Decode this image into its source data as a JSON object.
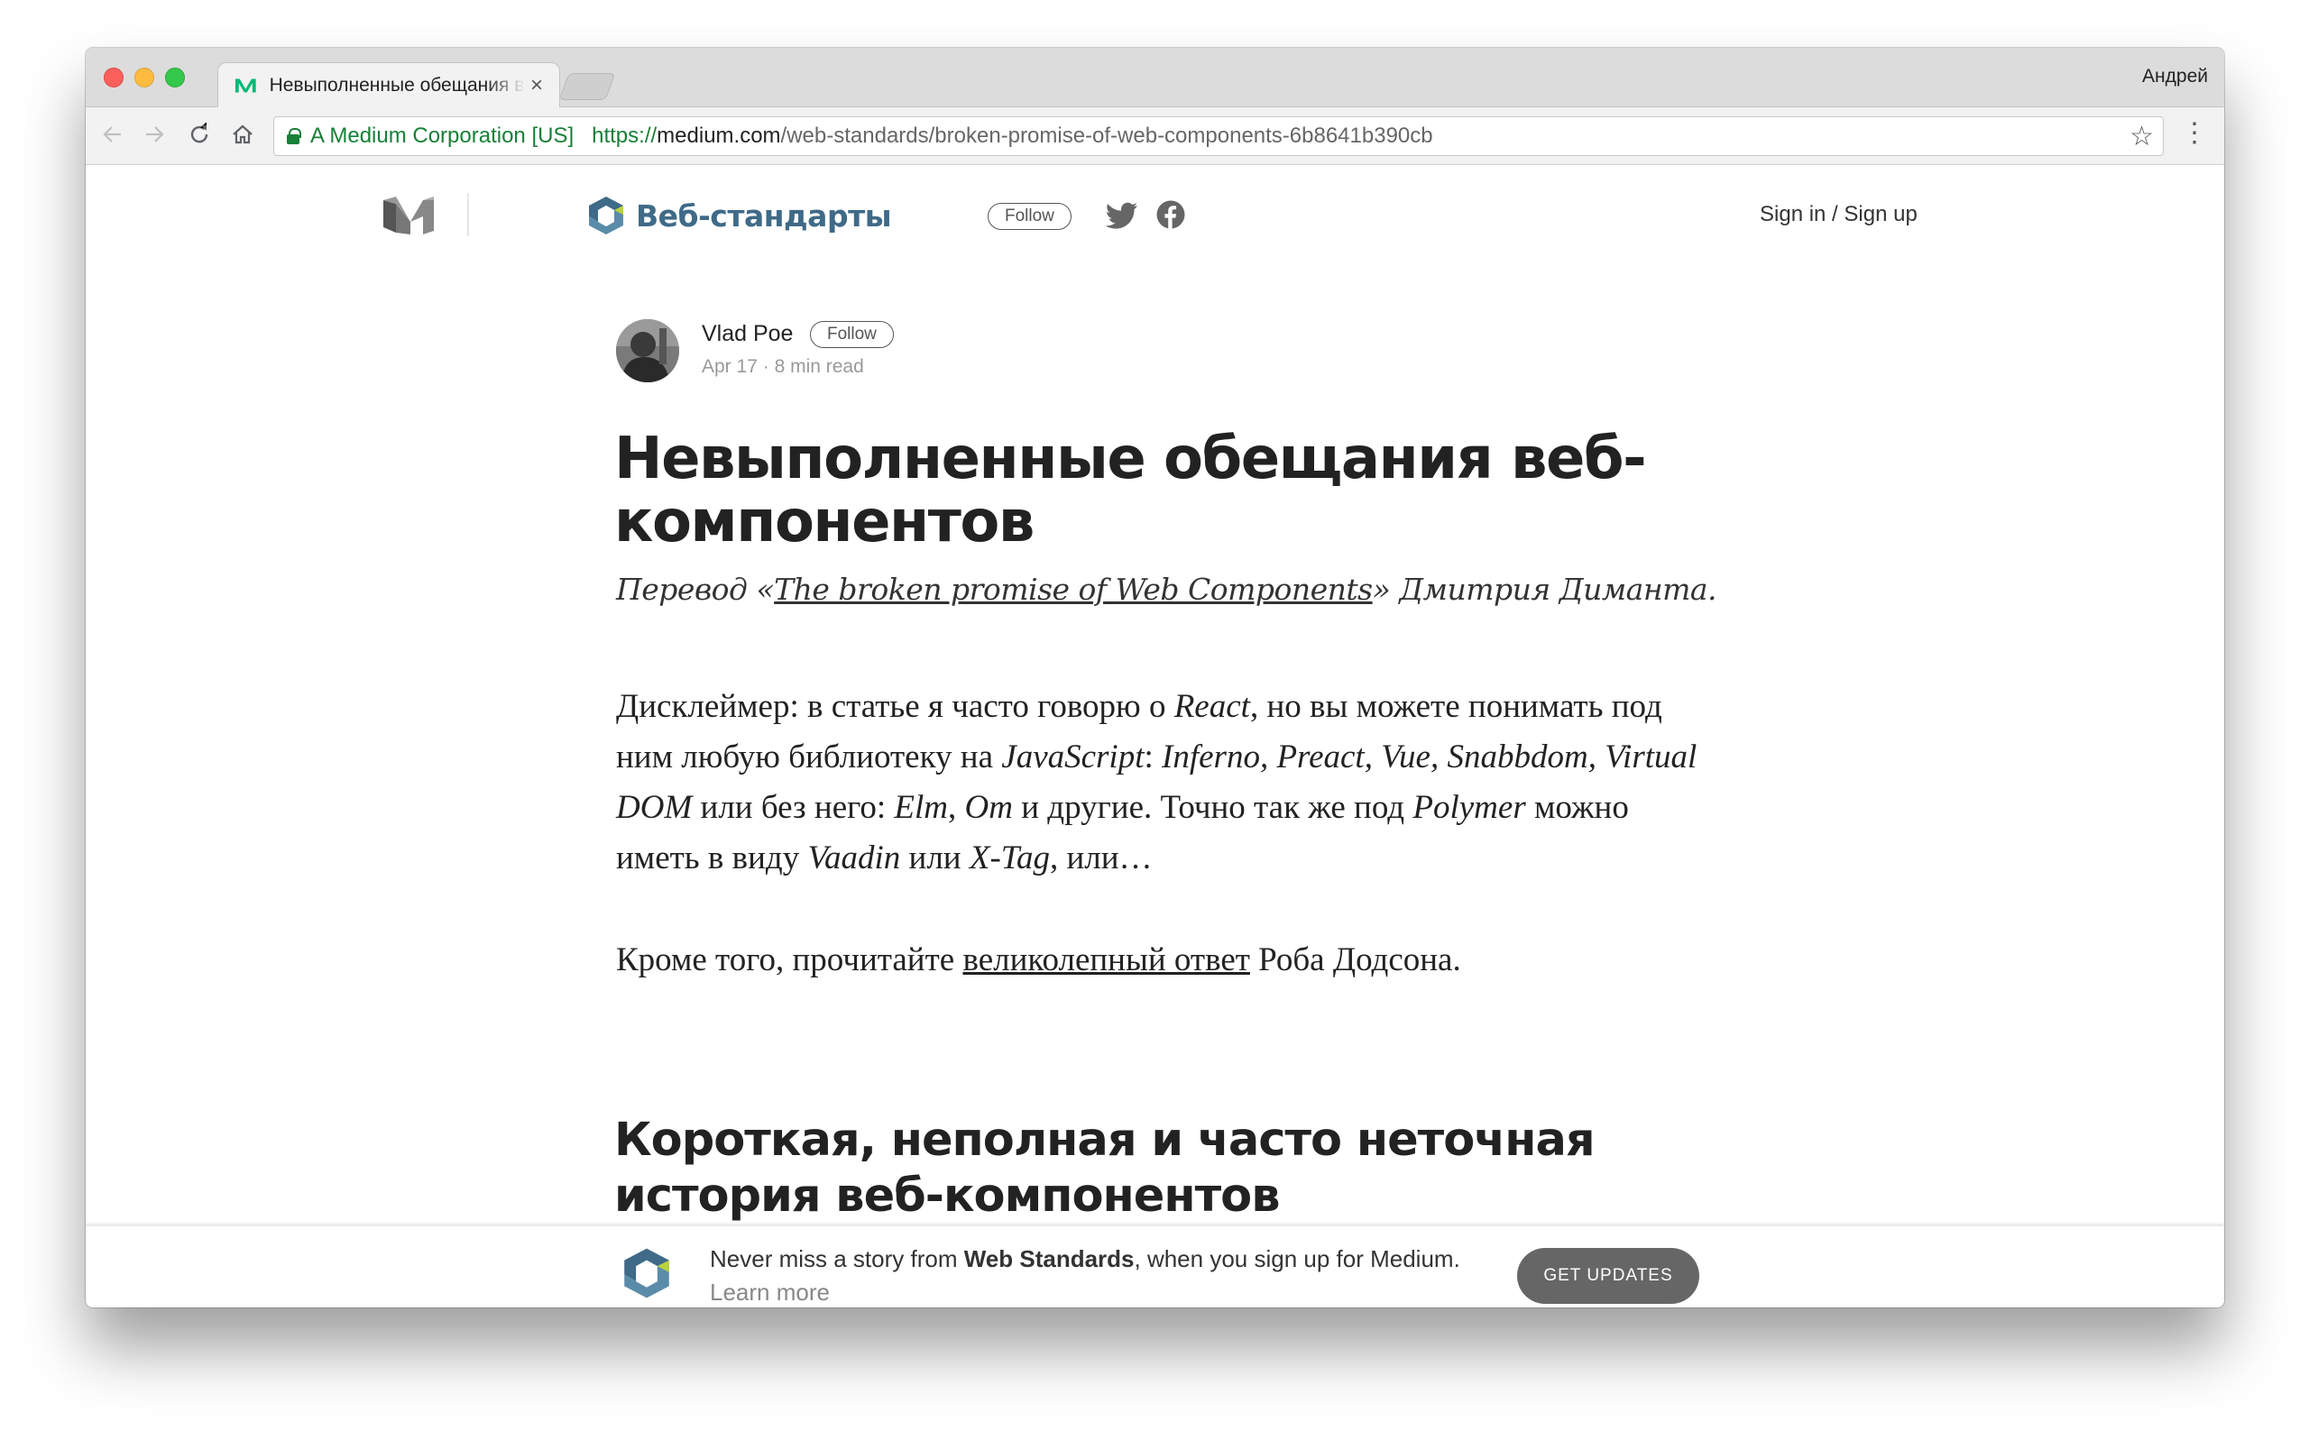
{
  "browser": {
    "tab_title": "Невыполненные обещания веб-компонентов",
    "tab_close": "×",
    "profile_name": "Андрей",
    "ev_name": "A Medium Corporation [US]",
    "url_scheme": "https://",
    "url_host": "medium.com",
    "url_path": "/web-standards/broken-promise-of-web-components-6b8641b390cb",
    "icons": [
      "back-arrow-icon",
      "forward-arrow-icon",
      "reload-icon",
      "home-icon",
      "lock-icon",
      "star-icon",
      "menu-dots-icon"
    ]
  },
  "header": {
    "publication_name": "Веб-стандарты",
    "follow_label": "Follow",
    "signin_label": "Sign in / Sign up",
    "colors": {
      "publication": "#3f6a88",
      "accent_green": "#02b875"
    }
  },
  "author": {
    "name": "Vlad Poe",
    "follow_label": "Follow",
    "date": "Apr 17",
    "separator": "·",
    "read_time": "8 min read"
  },
  "article": {
    "title": "Невыполненные обещания веб-компонентов",
    "subtitle_pre": "Перевод «",
    "subtitle_link": "The broken promise of Web Components",
    "subtitle_post": "» Дмитрия Диманта.",
    "p1": [
      "Дисклеймер: в статье я часто говорю о ",
      "React",
      ", но вы можете понимать под ним любую библиотеку на ",
      "JavaScript",
      ": ",
      "Inferno, Preact, Vue, Snabbdom, Virtual DOM",
      " или без него: ",
      "Elm",
      ", ",
      "Om",
      " и другие. Точно так же под ",
      "Polymer",
      " можно иметь в виду ",
      "Vaadin",
      " или ",
      "X-Tag",
      ", или…"
    ],
    "p2_pre": "Кроме того, прочитайте ",
    "p2_link": "великолепный ответ",
    "p2_post": " Роба Додсона.",
    "section_title": "Короткая, неполная и часто неточная история веб-компонентов"
  },
  "banner": {
    "text_pre": "Never miss a story from ",
    "text_bold": "Web Standards",
    "text_post": ", when you sign up for Medium. ",
    "learn_more": "Learn more",
    "button_label": "GET UPDATES"
  }
}
